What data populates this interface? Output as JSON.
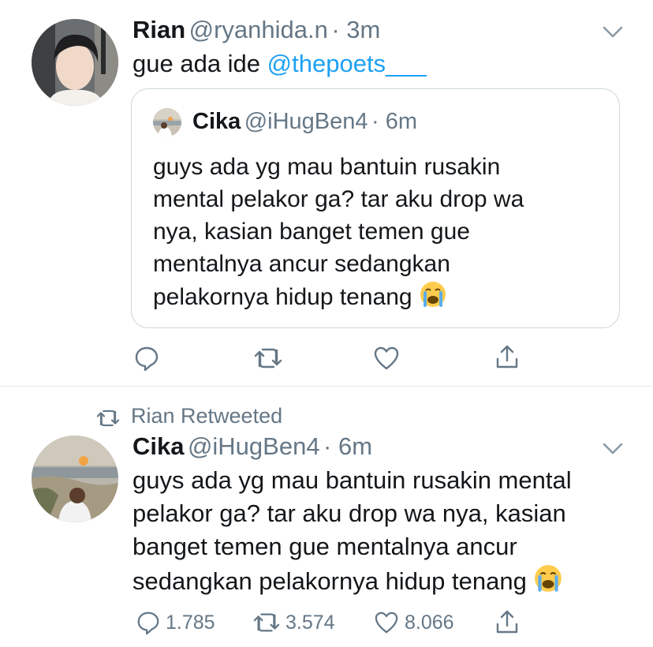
{
  "colors": {
    "accent": "#1da1f2",
    "muted": "#657786",
    "text": "#14171a",
    "border": "#ccd6dd"
  },
  "tweet1": {
    "name": "Rian",
    "handle": "@ryanhida.n",
    "time": "· 3m",
    "text": "gue ada ide ",
    "mention": "@thepoets___",
    "quoted": {
      "name": "Cika",
      "handle": "@iHugBen4",
      "time": "· 6m",
      "lines": [
        "guys ada yg mau bantuin rusakin",
        "mental pelakor ga? tar aku drop wa",
        "nya, kasian banget temen gue",
        "mentalnya ancur sedangkan",
        "pelakornya hidup tenang"
      ],
      "emoji": "loudly-crying-face"
    },
    "actions": {
      "reply_icon": "reply-icon",
      "retweet_icon": "retweet-icon",
      "like_icon": "heart-icon",
      "share_icon": "share-icon"
    }
  },
  "tweet2": {
    "retweeted_by": "Rian Retweeted",
    "name": "Cika",
    "handle": "@iHugBen4",
    "time": "· 6m",
    "lines": [
      "guys ada yg mau bantuin rusakin mental",
      "pelakor ga? tar aku drop wa nya, kasian",
      "banget temen gue mentalnya ancur",
      "sedangkan pelakornya hidup tenang"
    ],
    "emoji": "loudly-crying-face",
    "counts": {
      "replies": "1.785",
      "retweets": "3.574",
      "likes": "8.066"
    }
  }
}
